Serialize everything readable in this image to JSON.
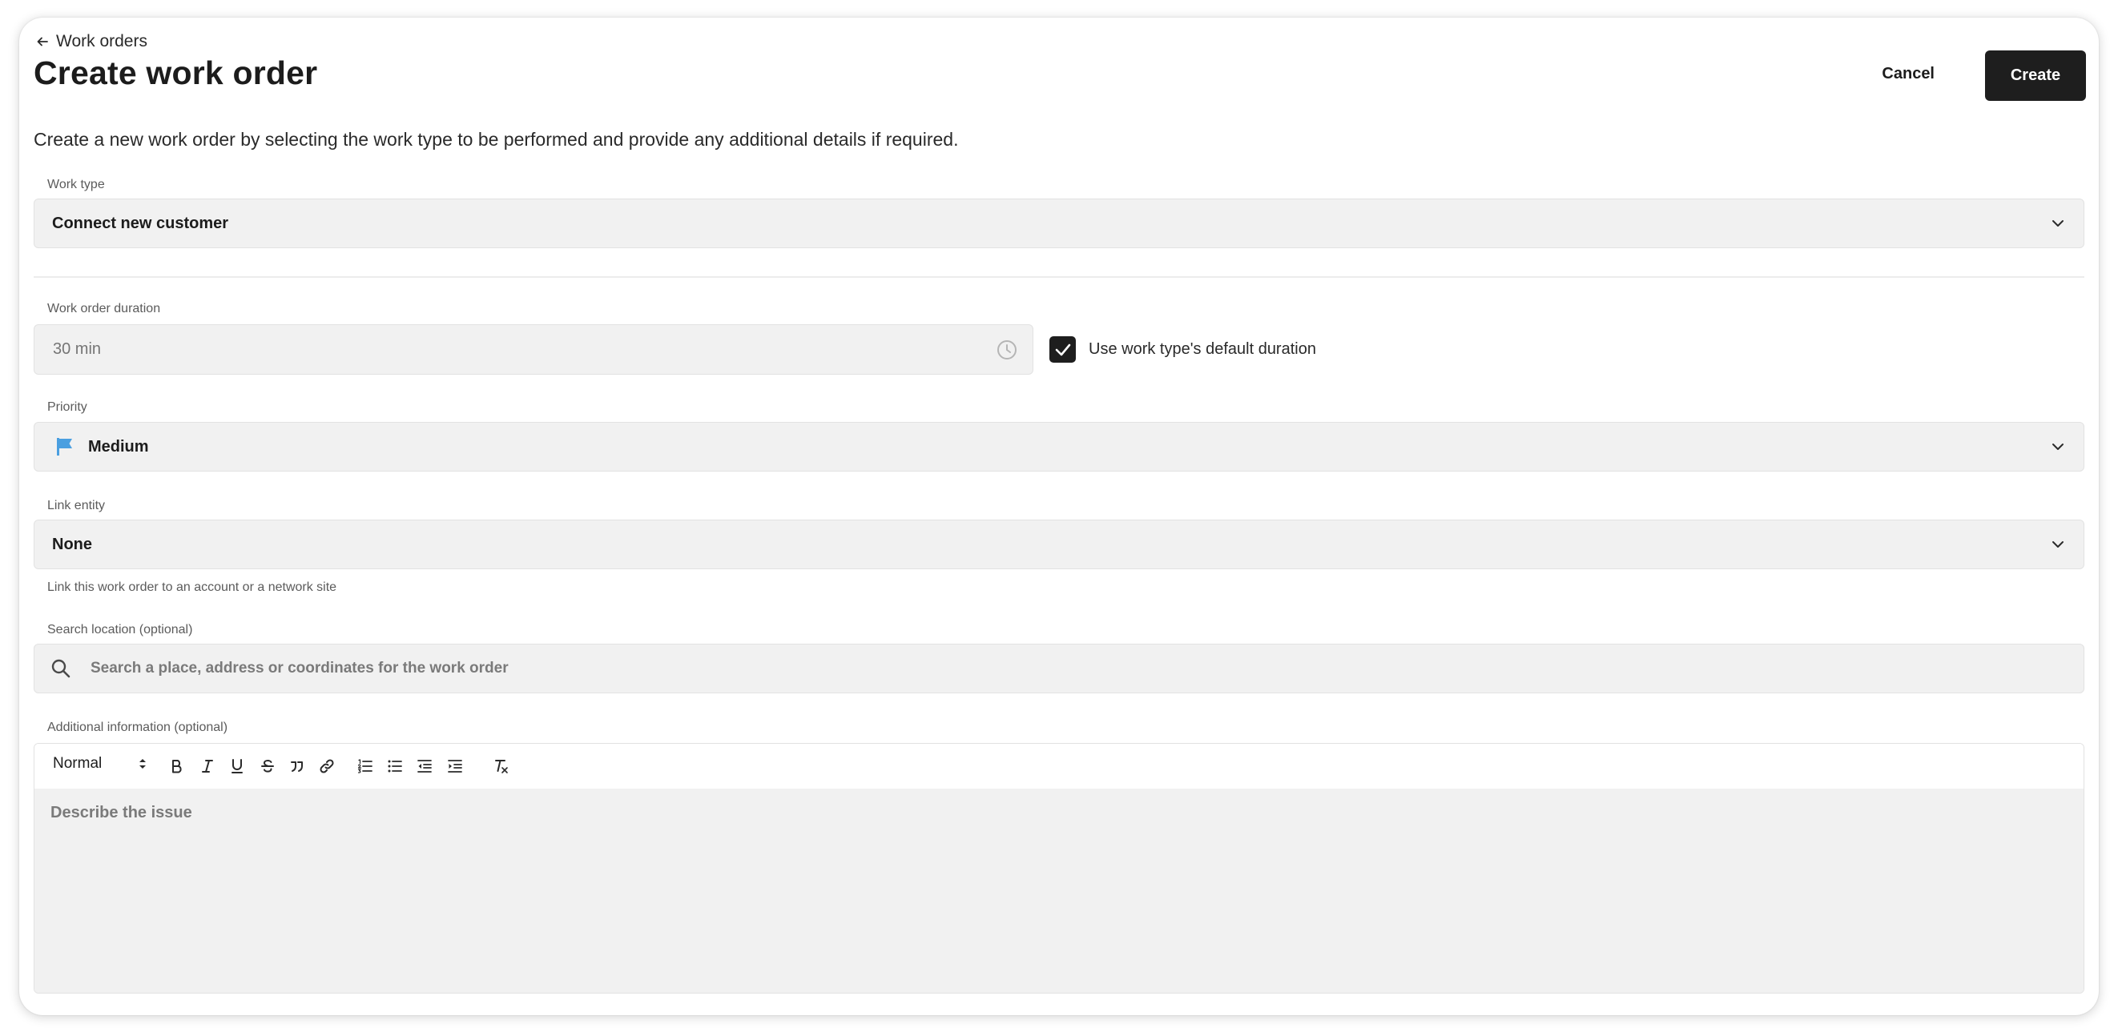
{
  "header": {
    "back_label": "Work orders",
    "title": "Create work order",
    "cancel_label": "Cancel",
    "create_label": "Create"
  },
  "intro_text": "Create a new work order by selecting the work type to be performed and provide any additional details if required.",
  "work_type": {
    "label": "Work type",
    "value": "Connect new customer"
  },
  "duration": {
    "label": "Work order duration",
    "placeholder": "30 min",
    "checkbox_label": "Use work type's default duration",
    "checkbox_checked": true
  },
  "priority": {
    "label": "Priority",
    "value": "Medium",
    "flag_color": "#4a9fe0"
  },
  "link_entity": {
    "label": "Link entity",
    "value": "None",
    "helper": "Link this work order to an account or a network site"
  },
  "search_location": {
    "label": "Search location (optional)",
    "placeholder": "Search a place, address or coordinates for the work order"
  },
  "additional_info": {
    "label": "Additional information (optional)",
    "text_style": "Normal",
    "placeholder": "Describe the issue",
    "toolbar_icons": [
      "bold-icon",
      "italic-icon",
      "underline-icon",
      "strikethrough-icon",
      "quote-icon",
      "link-icon",
      "ordered-list-icon",
      "bullet-list-icon",
      "outdent-icon",
      "indent-icon",
      "clear-format-icon"
    ]
  },
  "colors": {
    "primary_button": "#1e1e1e",
    "field_background": "#f1f1f1",
    "accent_flag": "#4a9fe0"
  }
}
